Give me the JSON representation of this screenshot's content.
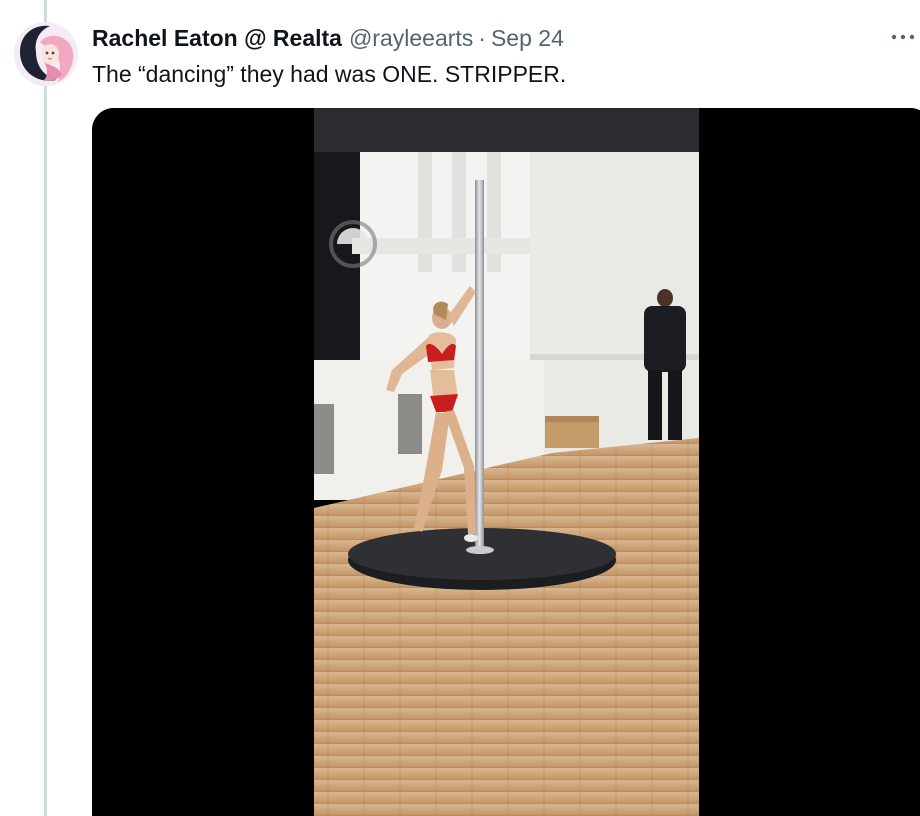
{
  "tweet": {
    "display_name": "Rachel Eaton @ Realta",
    "handle": "@rayleearts",
    "separator": "·",
    "date": "Sep 24",
    "text": "The “dancing” they had was ONE. STRIPPER.",
    "more_icon": "more-horizontal-icon"
  },
  "media": {
    "type": "video",
    "subject": "pole dancer on stage platform",
    "colors": {
      "letterbox": "#000000",
      "wall": "#f0f0ee",
      "floor": "#c9a072",
      "stage": "#2b2c30",
      "outfit": "#c81e1e",
      "pole": "#b9bcbf"
    }
  }
}
